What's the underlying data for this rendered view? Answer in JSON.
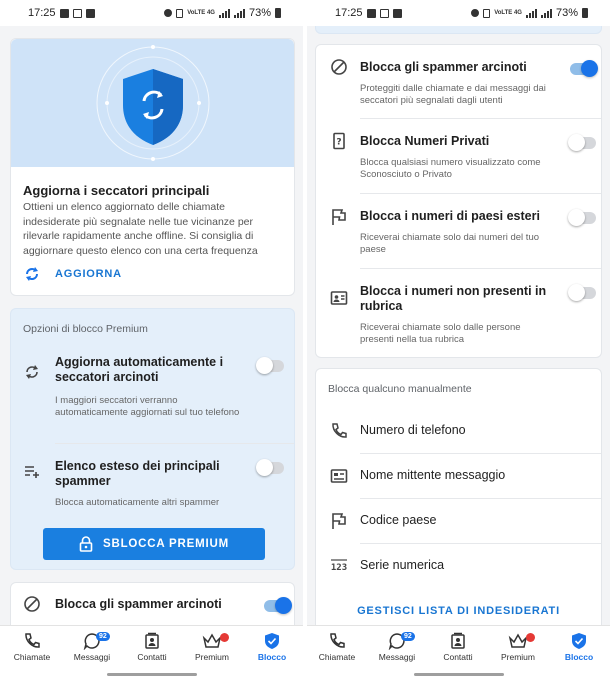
{
  "status_bar": {
    "time": "17:25",
    "network": "VoLTE 4G",
    "battery": "73%"
  },
  "left": {
    "top_list": {
      "title": "Aggiorna i seccatori principali",
      "description": "Ottieni un elenco aggiornato delle chiamate indesiderate più segnalate nelle tue vicinanze per rilevarle rapidamente anche offline. Si consiglia di aggiornare questo elenco con una certa frequenza",
      "update_button": "AGGIORNA"
    },
    "premium": {
      "section_label": "Opzioni di blocco Premium",
      "auto_update": {
        "title": "Aggiorna automaticamente i seccatori arcinoti",
        "description": "I maggiori seccatori verranno automaticamente aggiornati sul tuo telefono",
        "enabled": false
      },
      "extended_list": {
        "title": "Elenco esteso dei principali spammer",
        "description": "Blocca automaticamente altri spammer",
        "enabled": false
      },
      "unlock_button": "SBLOCCA PREMIUM"
    },
    "partial_row": {
      "title": "Blocca gli spammer arcinoti",
      "enabled": true
    }
  },
  "right": {
    "toggles": [
      {
        "title": "Blocca gli spammer arcinoti",
        "description": "Proteggiti dalle chiamate e dai messaggi dai seccatori più segnalati dagli utenti",
        "enabled": true,
        "icon": "block-icon"
      },
      {
        "title": "Blocca Numeri Privati",
        "description": "Blocca qualsiasi numero visualizzato come Sconosciuto o Privato",
        "enabled": false,
        "icon": "unknown-number-icon"
      },
      {
        "title": "Blocca i numeri di paesi esteri",
        "description": "Riceverai chiamate solo dai numeri del tuo paese",
        "enabled": false,
        "icon": "flag-icon"
      },
      {
        "title": "Blocca i numeri non presenti in rubrica",
        "description": "Riceverai chiamate solo dalle persone presenti nella tua rubrica",
        "enabled": false,
        "icon": "contact-card-icon"
      }
    ],
    "manual": {
      "section_label": "Blocca qualcuno manualmente",
      "items": [
        {
          "label": "Numero di telefono",
          "icon": "phone-icon"
        },
        {
          "label": "Nome mittente messaggio",
          "icon": "sender-card-icon"
        },
        {
          "label": "Codice paese",
          "icon": "flag-icon"
        },
        {
          "label": "Serie numerica",
          "icon": "number-series-icon"
        }
      ],
      "manage_link": "GESTISCI LISTA DI INDESIDERATI"
    }
  },
  "nav": {
    "items": [
      {
        "label": "Chiamate",
        "icon": "phone-icon"
      },
      {
        "label": "Messaggi",
        "icon": "chat-icon",
        "badge": "92"
      },
      {
        "label": "Contatti",
        "icon": "contacts-icon"
      },
      {
        "label": "Premium",
        "icon": "crown-icon"
      },
      {
        "label": "Blocco",
        "icon": "shield-icon",
        "active": true
      }
    ]
  },
  "colors": {
    "accent": "#1a73e8",
    "hero_bg": "#cfe3f8",
    "premium_card_bg": "#e4effa",
    "badge_red": "#e53935"
  }
}
